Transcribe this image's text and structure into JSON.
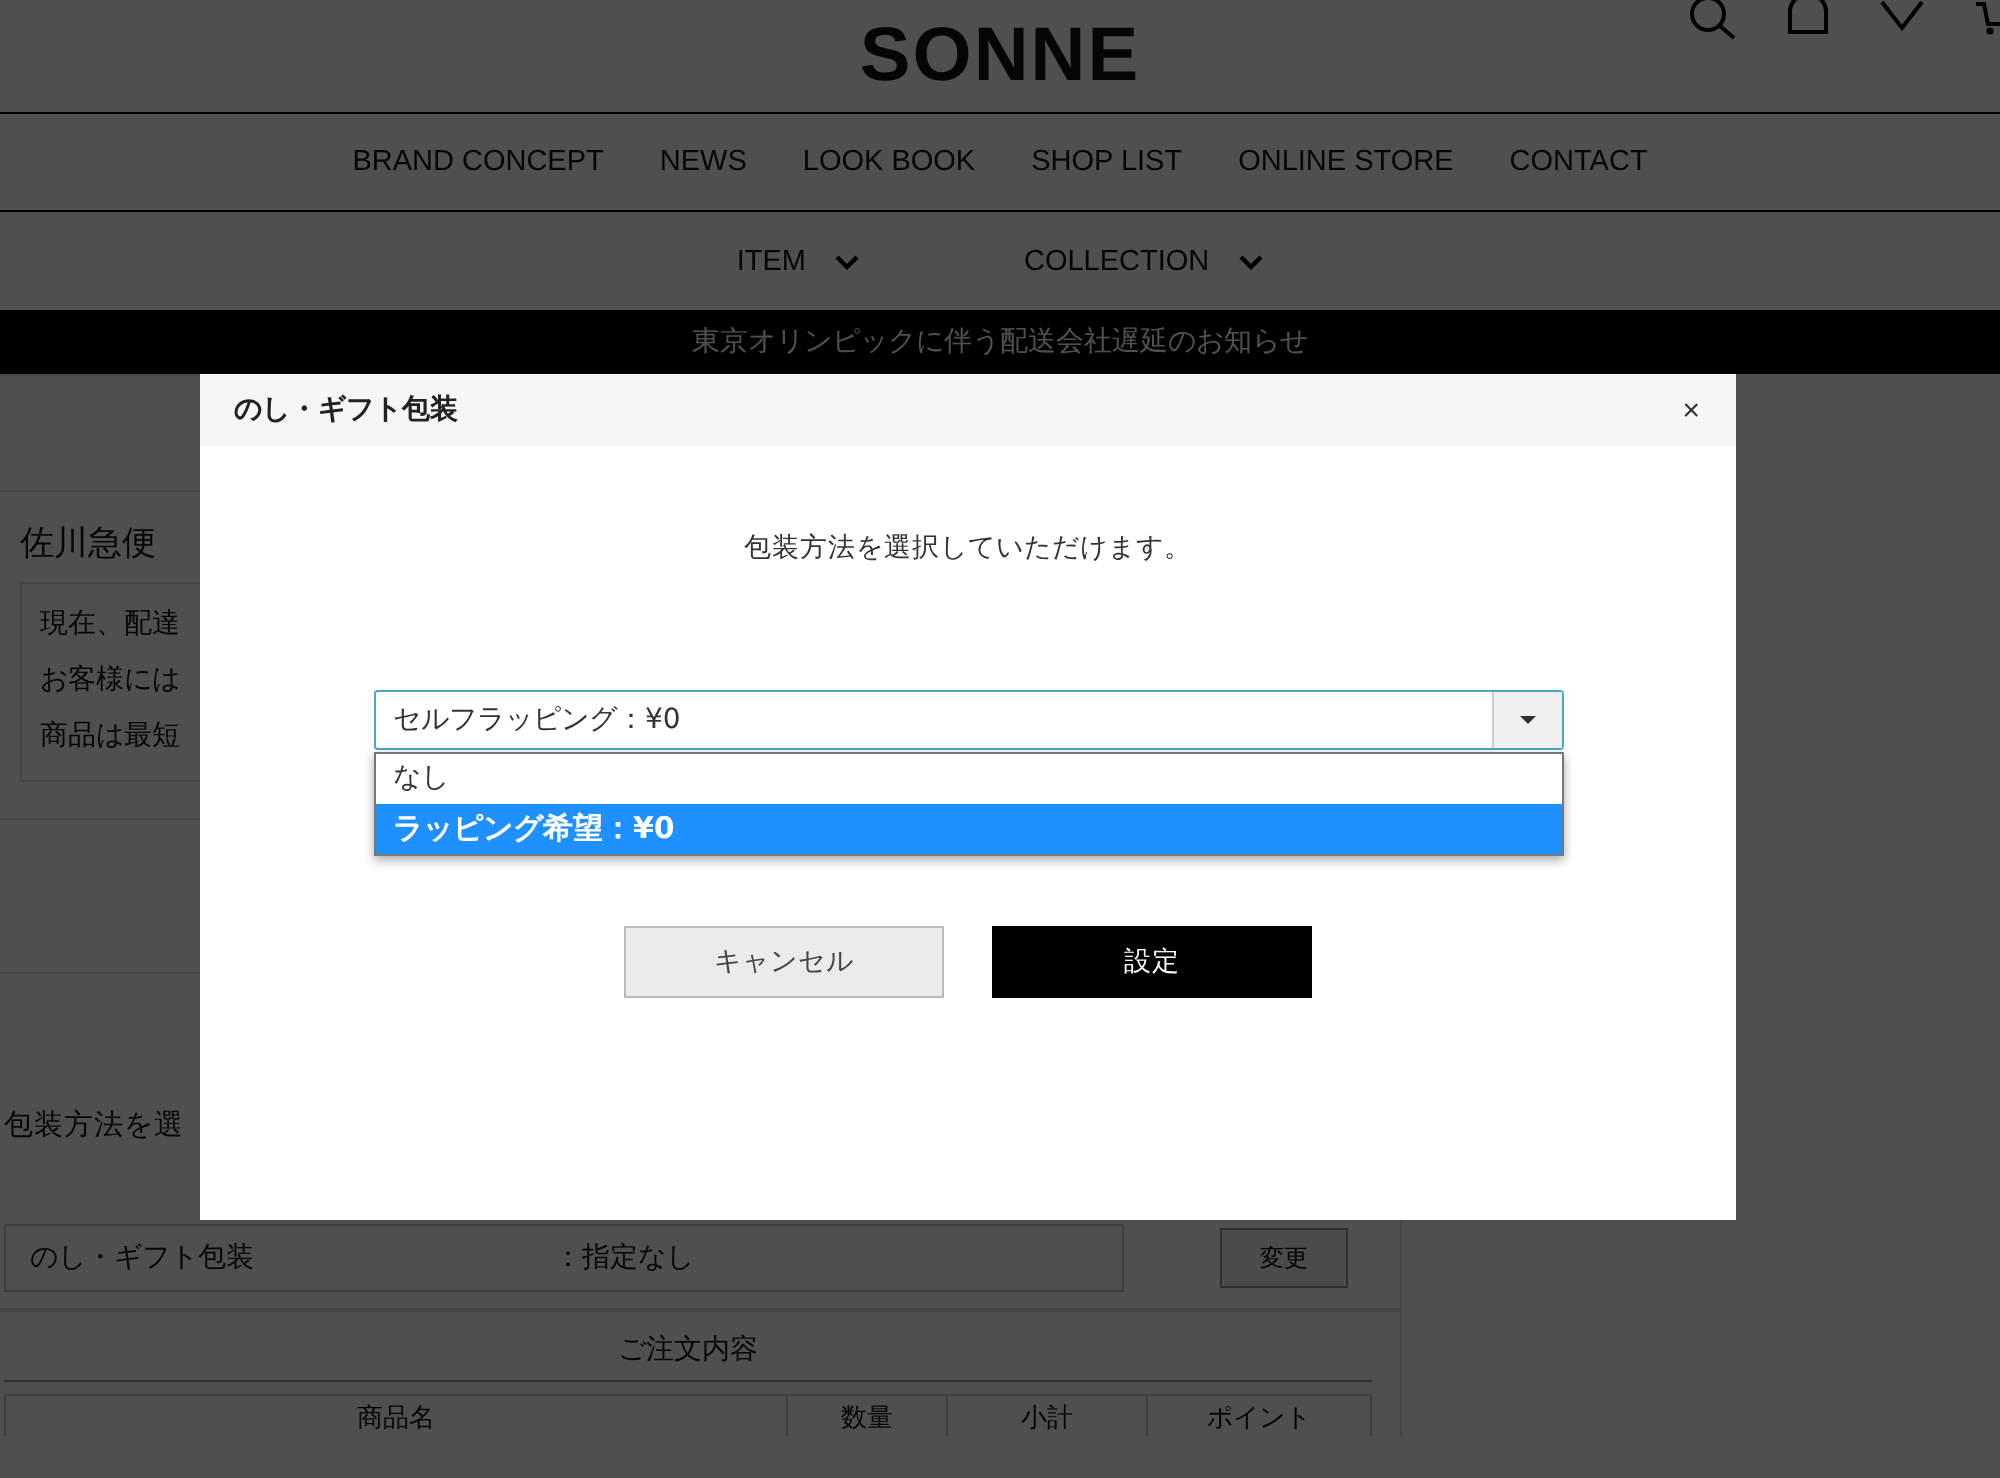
{
  "site": {
    "logo": "SONNE"
  },
  "nav": [
    {
      "label": "BRAND CONCEPT"
    },
    {
      "label": "NEWS"
    },
    {
      "label": "LOOK BOOK"
    },
    {
      "label": "SHOP LIST"
    },
    {
      "label": "ONLINE STORE"
    },
    {
      "label": "CONTACT"
    }
  ],
  "subnav": [
    {
      "label": "ITEM"
    },
    {
      "label": "COLLECTION"
    }
  ],
  "notice_banner": "東京オリンピックに伴う配送会社遅延のお知らせ",
  "shipping_notice": {
    "carrier": "佐川急便",
    "lines": [
      "現在、配達",
      "お客様には",
      "商品は最短"
    ]
  },
  "wrapping_section": {
    "prompt": "包装方法を選",
    "field_label": "のし・ギフト包装",
    "field_value": "：指定なし",
    "change_button": "変更"
  },
  "order_section": {
    "title": "ご注文内容",
    "columns": [
      "商品名",
      "数量",
      "小計",
      "ポイント"
    ]
  },
  "dialog": {
    "title": "のし・ギフト包装",
    "close": "×",
    "message": "包装方法を選択していただけます。",
    "select": {
      "value": "セルフラッピング：¥0",
      "options": [
        {
          "label": "なし",
          "selected": false
        },
        {
          "label": "ラッピング希望：¥0",
          "selected": true
        }
      ]
    },
    "buttons": [
      {
        "label": "キャンセル",
        "kind": "secondary"
      },
      {
        "label": "設定",
        "kind": "primary"
      }
    ]
  }
}
